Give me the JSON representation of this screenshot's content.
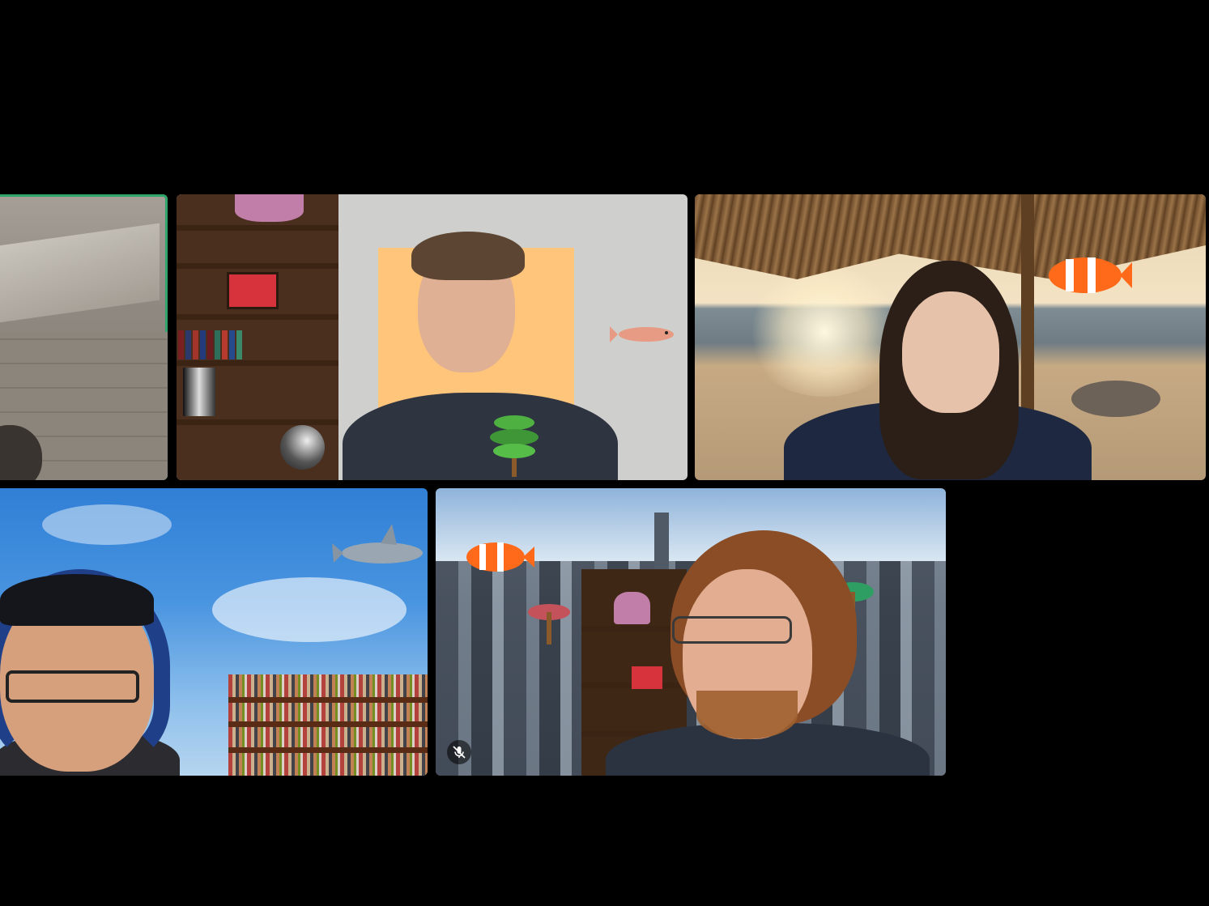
{
  "app": {
    "view_mode": "gallery"
  },
  "participants": [
    {
      "id": "p1",
      "name": "",
      "active_speaker": true,
      "muted": false,
      "background": "room-wall",
      "bg_color": "#8f8a84"
    },
    {
      "id": "p2",
      "name": "",
      "active_speaker": false,
      "muted": false,
      "background": "bookshelf-with-3d-objects",
      "bg_color": "#cfd0ce"
    },
    {
      "id": "p3",
      "name": "",
      "active_speaker": false,
      "muted": false,
      "background": "beach-palm-hut",
      "bg_color": "#c9a77d"
    },
    {
      "id": "p4",
      "name": "",
      "active_speaker": false,
      "muted": false,
      "background": "blue-sky-library",
      "bg_color": "#2f7fd6"
    },
    {
      "id": "p5",
      "name": "",
      "active_speaker": false,
      "muted": true,
      "background": "city-skyline",
      "bg_color": "#8fa7bf"
    }
  ],
  "colors": {
    "active_speaker_outline": "#2fa56a",
    "window_bg": "#000000"
  },
  "icons": {
    "mute": "microphone-off-icon"
  }
}
